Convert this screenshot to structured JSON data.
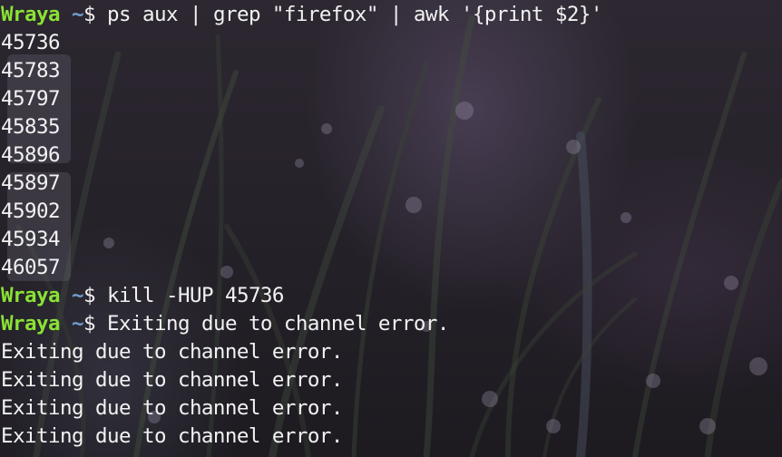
{
  "terminal": {
    "cmd1": {
      "user": "Wraya",
      "path": "~",
      "symbol": "$ ",
      "command": "ps aux | grep \"firefox\" | awk '{print $2}'"
    },
    "pids": [
      "45736",
      "45783",
      "45797",
      "45835",
      "45896",
      "45897",
      "45902",
      "45934",
      "46057"
    ],
    "cmd2": {
      "user": "Wraya",
      "path": "~",
      "symbol": "$ ",
      "command": "kill -HUP 45736"
    },
    "cmd3": {
      "user": "Wraya",
      "path": "~",
      "symbol": "$ ",
      "text": "Exiting due to channel error."
    },
    "errors": [
      "Exiting due to channel error.",
      "Exiting due to channel error.",
      "Exiting due to channel error.",
      "Exiting due to channel error."
    ]
  },
  "colors": {
    "user": "#8ae234",
    "path": "#729fcf",
    "text": "#f2f2f2",
    "background": "#26222a"
  }
}
